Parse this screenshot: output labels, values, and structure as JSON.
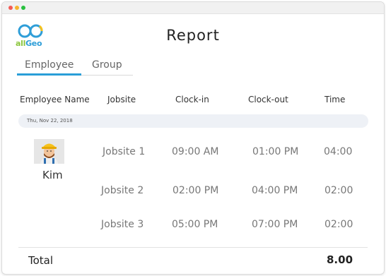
{
  "window": {
    "controls": [
      "close",
      "minimize",
      "maximize"
    ]
  },
  "logo": {
    "text_all": "all",
    "text_geo": "Geo",
    "colors": {
      "green": "#8cc63e",
      "blue": "#2f9ed8",
      "yellow": "#f6c21c"
    }
  },
  "page": {
    "title": "Report"
  },
  "tabs": [
    {
      "label": "Employee",
      "active": true
    },
    {
      "label": "Group",
      "active": false
    }
  ],
  "table": {
    "headers": [
      "Employee Name",
      "Jobsite",
      "Clock-in",
      "Clock-out",
      "Time"
    ],
    "date": "Thu, Nov 22, 2018",
    "employee": {
      "name": "Kim"
    },
    "rows": [
      {
        "jobsite": "Jobsite 1",
        "clock_in": "09:00 AM",
        "clock_out": "01:00 PM",
        "time": "04:00"
      },
      {
        "jobsite": "Jobsite 2",
        "clock_in": "02:00 PM",
        "clock_out": "04:00 PM",
        "time": "02:00"
      },
      {
        "jobsite": "Jobsite 3",
        "clock_in": "05:00 PM",
        "clock_out": "07:00 PM",
        "time": "02:00"
      }
    ],
    "total_label": "Total",
    "total_value": "8.00"
  },
  "accent_color": "#2a9ed8"
}
